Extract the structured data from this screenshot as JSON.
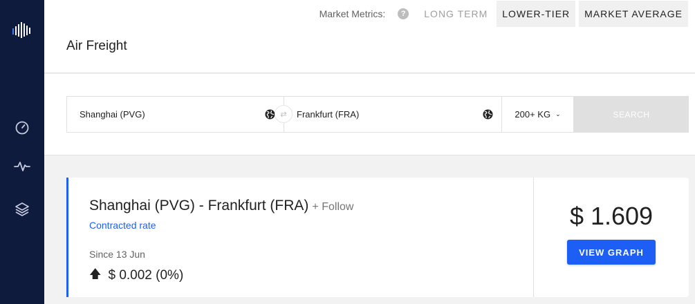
{
  "header": {
    "metrics_label": "Market Metrics:",
    "help_glyph": "?",
    "metric_buttons": [
      {
        "label": "LONG TERM",
        "state": "inactive"
      },
      {
        "label": "LOWER-TIER",
        "state": "active"
      },
      {
        "label": "MARKET AVERAGE",
        "state": "active"
      }
    ],
    "title": "Air Freight"
  },
  "sidebar": {
    "items": [
      {
        "icon": "speedometer-icon"
      },
      {
        "icon": "activity-icon"
      },
      {
        "icon": "layers-icon"
      }
    ]
  },
  "search": {
    "origin": "Shanghai (PVG)",
    "destination": "Frankfurt (FRA)",
    "swap_glyph": "⇄",
    "weight": "200+ KG",
    "weight_chevron": "⌄",
    "button_label": "SEARCH"
  },
  "result": {
    "route": "Shanghai (PVG) - Frankfurt (FRA)",
    "follow_label": "+ Follow",
    "rate_type": "Contracted rate",
    "since_label": "Since 13 Jun",
    "change_arrow": "🡅",
    "change": "$ 0.002 (0%)",
    "price": "$ 1.609",
    "view_graph_label": "VIEW GRAPH"
  },
  "colors": {
    "sidebar_bg": "#0f1b3d",
    "accent": "#1d5ef5",
    "search_disabled": "#e0e0e0"
  }
}
